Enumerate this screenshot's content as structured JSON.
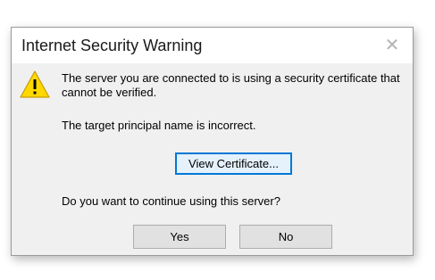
{
  "dialog": {
    "title": "Internet Security Warning",
    "close_icon": "close-icon",
    "warning_icon": "warning-triangle-icon",
    "message_line1": "The server you are connected to is using a security certificate that cannot be verified.",
    "message_line2": "The target principal name is incorrect.",
    "question": "Do you want to continue using this server?",
    "buttons": {
      "view_certificate": "View Certificate...",
      "yes": "Yes",
      "no": "No"
    }
  },
  "colors": {
    "dialog_bg": "#f0f0f0",
    "titlebar_bg": "#ffffff",
    "focus_accent": "#0078d7",
    "warning_yellow": "#ffd800"
  }
}
